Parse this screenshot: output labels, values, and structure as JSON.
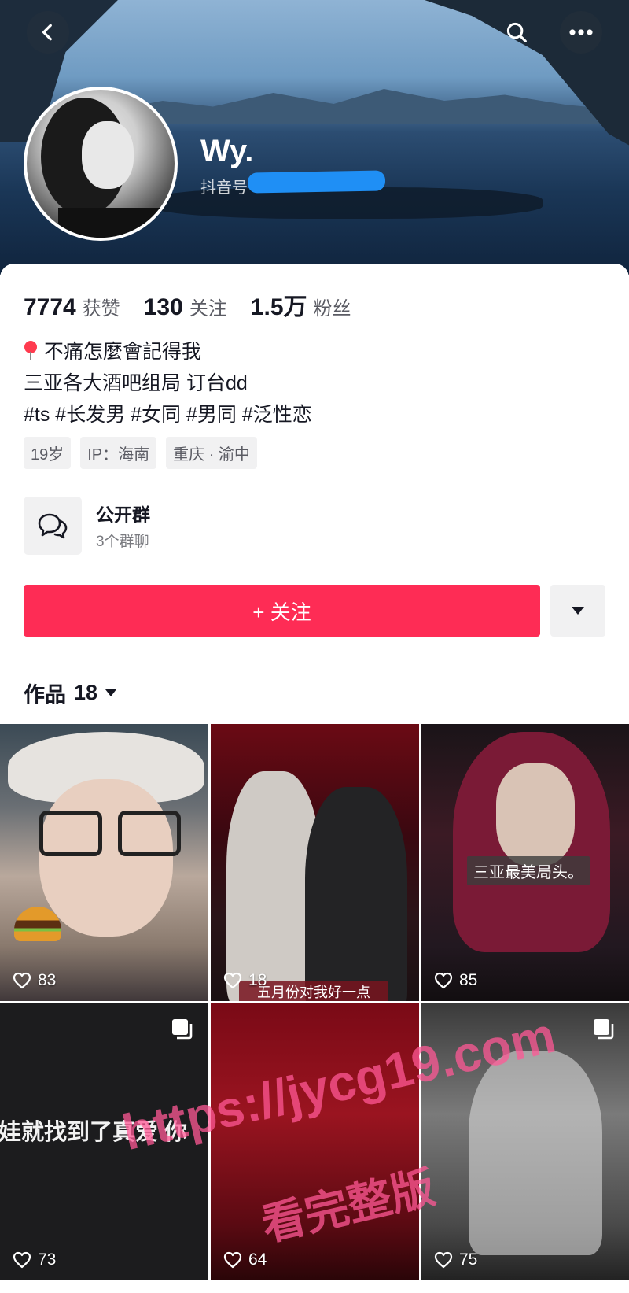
{
  "profile": {
    "name": "Wy.",
    "douyin_id_label": "抖音号"
  },
  "stats": [
    {
      "num": "7774",
      "label": "获赞"
    },
    {
      "num": "130",
      "label": "关注"
    },
    {
      "num": "1.5万",
      "label": "粉丝"
    }
  ],
  "bio": {
    "line1": "不痛怎麼會記得我",
    "line2": "三亚各大酒吧组局 订台dd",
    "line3": "#ts #长发男 #女同 #男同 #泛性恋"
  },
  "tags": [
    "19岁",
    "IP：海南",
    "重庆 · 渝中"
  ],
  "group": {
    "title": "公开群",
    "subtitle": "3个群聊"
  },
  "actions": {
    "follow_label": "+ 关注"
  },
  "works": {
    "label": "作品",
    "count": "18"
  },
  "videos": [
    {
      "likes": "83"
    },
    {
      "likes": "18",
      "caption": "五月份对我好一点"
    },
    {
      "likes": "85",
      "caption": "三亚最美局头。"
    },
    {
      "likes": "73",
      "caption": "娃就找到了真爱  你"
    },
    {
      "likes": "64"
    },
    {
      "likes": "75"
    }
  ],
  "watermark": {
    "line1": "https://jycg19.com",
    "line2": "看完整版"
  },
  "colors": {
    "accent": "#fe2c55",
    "text": "#161823",
    "secondary": "#5a5b63"
  },
  "icons": {
    "back": "chevron-left-icon",
    "search": "search-icon",
    "more": "more-dots-icon",
    "group": "chat-bubbles-icon",
    "dropdown": "caret-down-icon",
    "like": "heart-icon",
    "multi": "multi-image-icon"
  }
}
